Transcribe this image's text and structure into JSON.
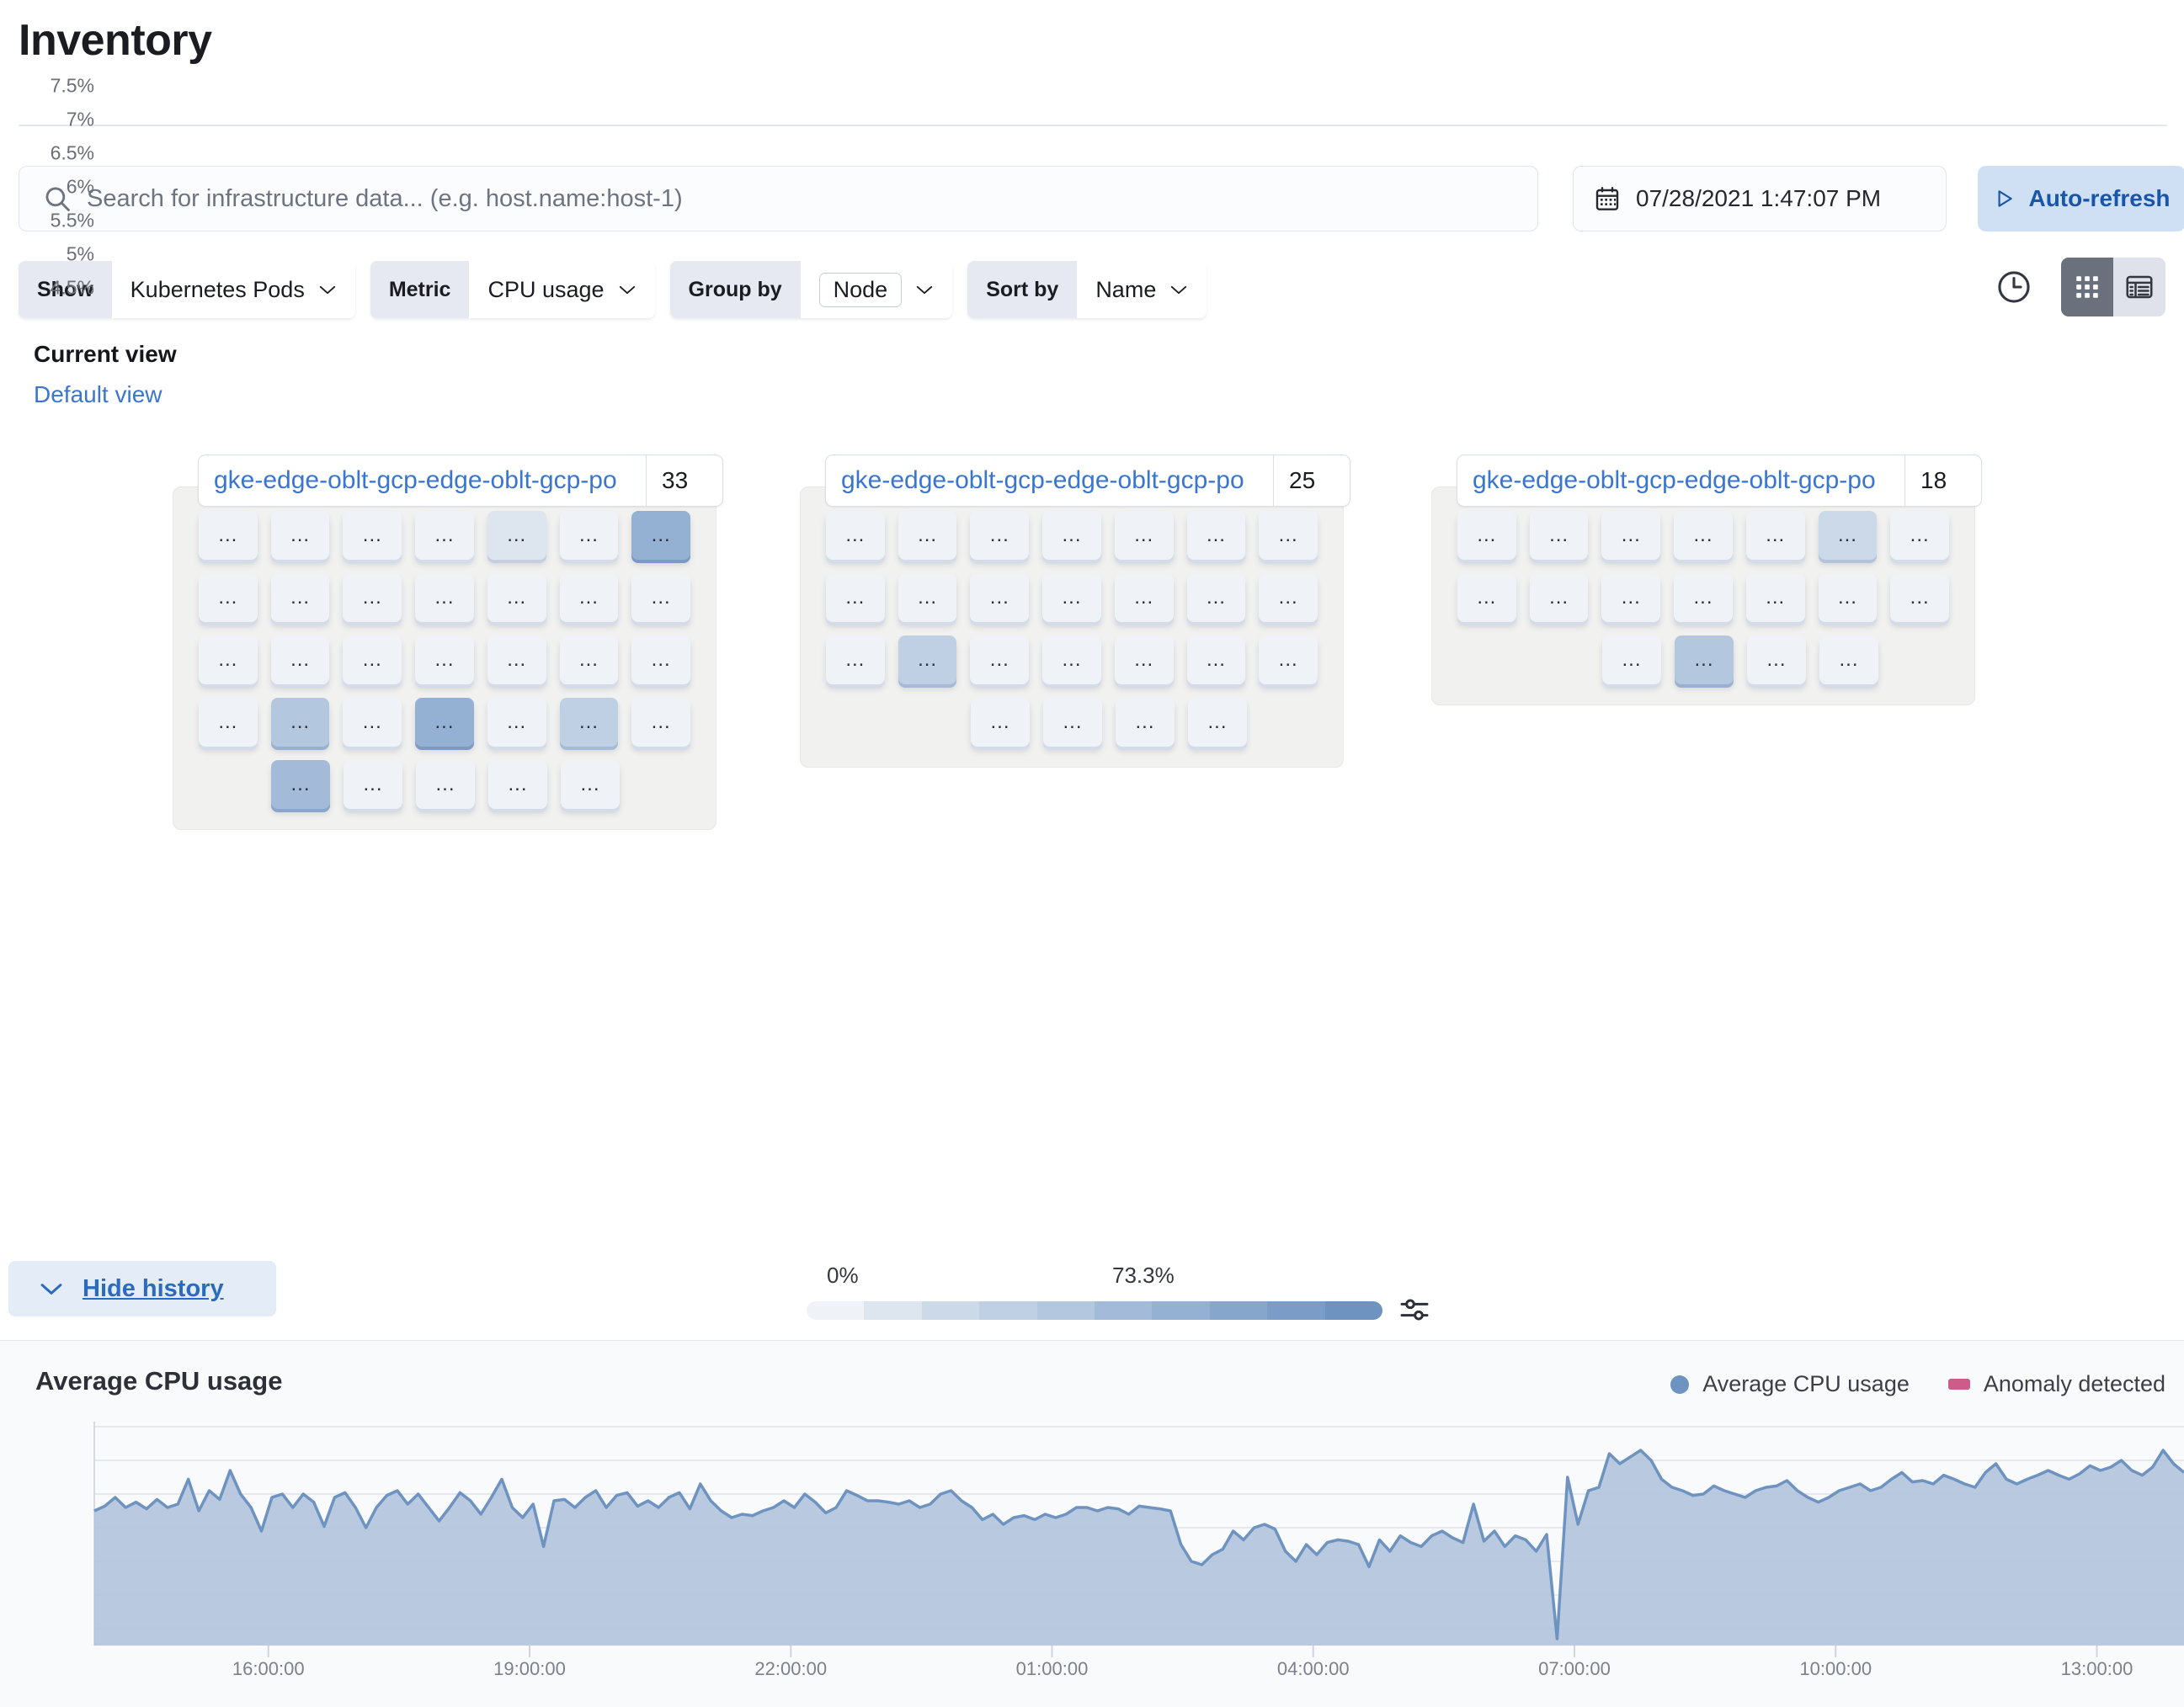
{
  "page": {
    "title": "Inventory"
  },
  "search": {
    "placeholder": "Search for infrastructure data... (e.g. host.name:host-1)",
    "icon": "search-icon"
  },
  "date_picker": {
    "value": "07/28/2021 1:47:07 PM",
    "icon": "calendar-icon"
  },
  "auto_refresh": {
    "label": "Auto-refresh",
    "icon": "play-icon",
    "background": "#cfe0f5",
    "text_color": "#1a56a8"
  },
  "filters": [
    {
      "label": "Show",
      "value": "Kubernetes Pods",
      "boxed": false,
      "name": "show"
    },
    {
      "label": "Metric",
      "value": "CPU usage",
      "boxed": false,
      "name": "metric"
    },
    {
      "label": "Group by",
      "value": "Node",
      "boxed": true,
      "name": "group-by"
    },
    {
      "label": "Sort by",
      "value": "Name",
      "boxed": false,
      "name": "sort-by"
    }
  ],
  "view_controls": {
    "clock_icon": "clock-icon",
    "map_view_icon": "grid-icon",
    "table_view_icon": "table-icon",
    "active_view": "map"
  },
  "current_view": {
    "title": "Current view",
    "link": "Default view"
  },
  "groups": [
    {
      "name": "gke-edge-oblt-gcp-edge-oblt-gcp-po",
      "count": "33",
      "rows": [
        {
          "offset": 0,
          "values": [
            0.02,
            0.03,
            0.02,
            0.03,
            0.14,
            0.04,
            0.62
          ]
        },
        {
          "offset": 0,
          "values": [
            0.02,
            0.02,
            0.03,
            0.02,
            0.02,
            0.03,
            0.02
          ]
        },
        {
          "offset": 0,
          "values": [
            0.02,
            0.02,
            0.02,
            0.03,
            0.02,
            0.02,
            0.02
          ]
        },
        {
          "offset": 0,
          "values": [
            0.03,
            0.4,
            0.02,
            0.62,
            0.03,
            0.38,
            0.02
          ]
        },
        {
          "offset": 1,
          "values": [
            0.6,
            0.03,
            0.03,
            0.03,
            0.04
          ]
        }
      ]
    },
    {
      "name": "gke-edge-oblt-gcp-edge-oblt-gcp-po",
      "count": "25",
      "rows": [
        {
          "offset": 0,
          "values": [
            0.02,
            0.02,
            0.02,
            0.02,
            0.02,
            0.02,
            0.03
          ]
        },
        {
          "offset": 0,
          "values": [
            0.02,
            0.02,
            0.02,
            0.02,
            0.02,
            0.02,
            0.02
          ]
        },
        {
          "offset": 0,
          "values": [
            0.02,
            0.34,
            0.02,
            0.02,
            0.02,
            0.02,
            0.02
          ]
        },
        {
          "offset": 2,
          "values": [
            0.02,
            0.02,
            0.03,
            0.02
          ]
        }
      ]
    },
    {
      "name": "gke-edge-oblt-gcp-edge-oblt-gcp-po",
      "count": "18",
      "rows": [
        {
          "offset": 0,
          "values": [
            0.02,
            0.02,
            0.02,
            0.02,
            0.03,
            0.2,
            0.02
          ]
        },
        {
          "offset": 0,
          "values": [
            0.02,
            0.02,
            0.02,
            0.02,
            0.03,
            0.02,
            0.02
          ]
        },
        {
          "offset": 2,
          "values": [
            0.02,
            0.48,
            0.02,
            0.03
          ]
        }
      ]
    }
  ],
  "node_label": "...",
  "legend": {
    "min": "0%",
    "max": "73.3%",
    "steps": [
      "#eff2f7",
      "#dde5ef",
      "#ccd9e9",
      "#bfd0e4",
      "#b3c7df",
      "#a3bbd8",
      "#94b0d2",
      "#86a6cc",
      "#7a9cc6",
      "#6e93c0"
    ],
    "settings_icon": "sliders-icon"
  },
  "hide_history": {
    "label": "Hide history",
    "icon": "chevron-down-icon"
  },
  "chart_data": {
    "type": "area",
    "title": "Average CPU usage",
    "xlabel": "",
    "ylabel": "",
    "grid": true,
    "legend_position": "top-right",
    "legend": [
      {
        "name": "Average CPU usage",
        "color": "#6e93c0",
        "marker": "circle"
      },
      {
        "name": "Anomaly detected",
        "color": "#cc5d8a",
        "marker": "rect"
      }
    ],
    "ylim": [
      4.25,
      7.75
    ],
    "yticks": [
      "7.5%",
      "7%",
      "6.5%",
      "6%",
      "5.5%",
      "5%",
      "4.5%"
    ],
    "ytick_values": [
      7.5,
      7,
      6.5,
      6,
      5.5,
      5,
      4.5
    ],
    "xticks": [
      "16:00:00",
      "19:00:00",
      "22:00:00",
      "01:00:00",
      "04:00:00",
      "07:00:00",
      "10:00:00",
      "13:00:00"
    ],
    "xtick_positions": [
      0.0833,
      0.2083,
      0.3333,
      0.4583,
      0.5833,
      0.7083,
      0.8333,
      0.9583
    ],
    "series": [
      {
        "name": "Average CPU usage",
        "color": "#6e93c0",
        "fill": "#aec1da",
        "values": [
          6.25,
          6.32,
          6.45,
          6.3,
          6.38,
          6.28,
          6.42,
          6.3,
          6.35,
          6.72,
          6.25,
          6.55,
          6.42,
          6.85,
          6.5,
          6.3,
          5.95,
          6.45,
          6.5,
          6.3,
          6.5,
          6.38,
          6.02,
          6.45,
          6.52,
          6.3,
          6.0,
          6.3,
          6.48,
          6.55,
          6.35,
          6.5,
          6.3,
          6.1,
          6.3,
          6.52,
          6.4,
          6.2,
          6.45,
          6.72,
          6.3,
          6.15,
          6.35,
          5.72,
          6.4,
          6.42,
          6.3,
          6.45,
          6.55,
          6.3,
          6.48,
          6.52,
          6.32,
          6.4,
          6.3,
          6.45,
          6.52,
          6.28,
          6.65,
          6.4,
          6.25,
          6.15,
          6.2,
          6.18,
          6.25,
          6.3,
          6.4,
          6.3,
          6.5,
          6.38,
          6.22,
          6.3,
          6.55,
          6.48,
          6.4,
          6.4,
          6.38,
          6.35,
          6.4,
          6.3,
          6.35,
          6.5,
          6.55,
          6.4,
          6.3,
          6.12,
          6.2,
          6.05,
          6.15,
          6.18,
          6.12,
          6.2,
          6.15,
          6.2,
          6.3,
          6.3,
          6.25,
          6.3,
          6.28,
          6.2,
          6.32,
          6.3,
          6.28,
          6.25,
          5.75,
          5.5,
          5.45,
          5.6,
          5.68,
          5.95,
          5.82,
          6.0,
          6.05,
          5.98,
          5.65,
          5.5,
          5.75,
          5.6,
          5.78,
          5.82,
          5.8,
          5.75,
          5.42,
          5.82,
          5.65,
          5.88,
          5.78,
          5.72,
          5.88,
          5.95,
          5.85,
          5.78,
          6.35,
          5.8,
          5.95,
          5.72,
          5.88,
          5.82,
          5.65,
          5.9,
          4.35,
          6.75,
          6.05,
          6.55,
          6.6,
          7.1,
          6.95,
          7.05,
          7.15,
          7.0,
          6.72,
          6.6,
          6.55,
          6.48,
          6.5,
          6.62,
          6.55,
          6.5,
          6.45,
          6.55,
          6.6,
          6.62,
          6.7,
          6.55,
          6.45,
          6.38,
          6.45,
          6.55,
          6.6,
          6.65,
          6.55,
          6.6,
          6.72,
          6.82,
          6.68,
          6.7,
          6.65,
          6.78,
          6.72,
          6.65,
          6.6,
          6.82,
          6.95,
          6.72,
          6.65,
          6.72,
          6.78,
          6.85,
          6.78,
          6.72,
          6.8,
          6.92,
          6.85,
          6.9,
          7.0,
          6.85,
          6.78,
          6.9,
          7.15,
          6.95,
          6.82
        ]
      }
    ]
  }
}
